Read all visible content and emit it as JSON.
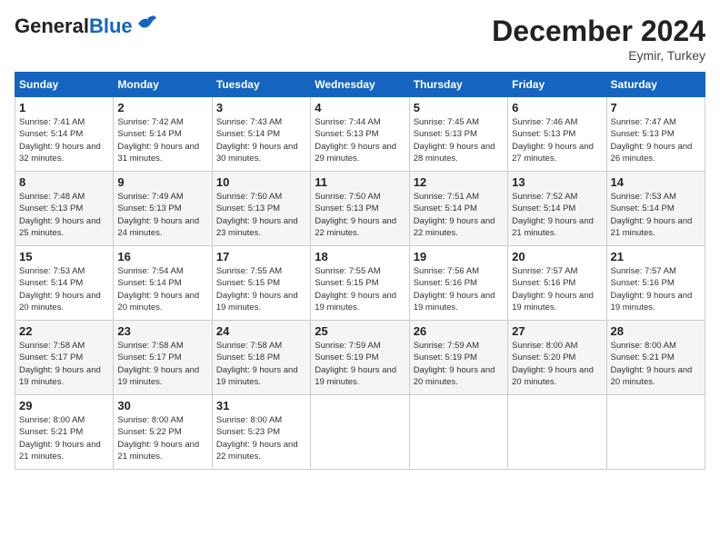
{
  "header": {
    "logo_general": "General",
    "logo_blue": "Blue",
    "month_title": "December 2024",
    "location": "Eymir, Turkey"
  },
  "weekdays": [
    "Sunday",
    "Monday",
    "Tuesday",
    "Wednesday",
    "Thursday",
    "Friday",
    "Saturday"
  ],
  "weeks": [
    [
      {
        "day": "1",
        "sunrise": "Sunrise: 7:41 AM",
        "sunset": "Sunset: 5:14 PM",
        "daylight": "Daylight: 9 hours and 32 minutes."
      },
      {
        "day": "2",
        "sunrise": "Sunrise: 7:42 AM",
        "sunset": "Sunset: 5:14 PM",
        "daylight": "Daylight: 9 hours and 31 minutes."
      },
      {
        "day": "3",
        "sunrise": "Sunrise: 7:43 AM",
        "sunset": "Sunset: 5:14 PM",
        "daylight": "Daylight: 9 hours and 30 minutes."
      },
      {
        "day": "4",
        "sunrise": "Sunrise: 7:44 AM",
        "sunset": "Sunset: 5:13 PM",
        "daylight": "Daylight: 9 hours and 29 minutes."
      },
      {
        "day": "5",
        "sunrise": "Sunrise: 7:45 AM",
        "sunset": "Sunset: 5:13 PM",
        "daylight": "Daylight: 9 hours and 28 minutes."
      },
      {
        "day": "6",
        "sunrise": "Sunrise: 7:46 AM",
        "sunset": "Sunset: 5:13 PM",
        "daylight": "Daylight: 9 hours and 27 minutes."
      },
      {
        "day": "7",
        "sunrise": "Sunrise: 7:47 AM",
        "sunset": "Sunset: 5:13 PM",
        "daylight": "Daylight: 9 hours and 26 minutes."
      }
    ],
    [
      {
        "day": "8",
        "sunrise": "Sunrise: 7:48 AM",
        "sunset": "Sunset: 5:13 PM",
        "daylight": "Daylight: 9 hours and 25 minutes."
      },
      {
        "day": "9",
        "sunrise": "Sunrise: 7:49 AM",
        "sunset": "Sunset: 5:13 PM",
        "daylight": "Daylight: 9 hours and 24 minutes."
      },
      {
        "day": "10",
        "sunrise": "Sunrise: 7:50 AM",
        "sunset": "Sunset: 5:13 PM",
        "daylight": "Daylight: 9 hours and 23 minutes."
      },
      {
        "day": "11",
        "sunrise": "Sunrise: 7:50 AM",
        "sunset": "Sunset: 5:13 PM",
        "daylight": "Daylight: 9 hours and 22 minutes."
      },
      {
        "day": "12",
        "sunrise": "Sunrise: 7:51 AM",
        "sunset": "Sunset: 5:14 PM",
        "daylight": "Daylight: 9 hours and 22 minutes."
      },
      {
        "day": "13",
        "sunrise": "Sunrise: 7:52 AM",
        "sunset": "Sunset: 5:14 PM",
        "daylight": "Daylight: 9 hours and 21 minutes."
      },
      {
        "day": "14",
        "sunrise": "Sunrise: 7:53 AM",
        "sunset": "Sunset: 5:14 PM",
        "daylight": "Daylight: 9 hours and 21 minutes."
      }
    ],
    [
      {
        "day": "15",
        "sunrise": "Sunrise: 7:53 AM",
        "sunset": "Sunset: 5:14 PM",
        "daylight": "Daylight: 9 hours and 20 minutes."
      },
      {
        "day": "16",
        "sunrise": "Sunrise: 7:54 AM",
        "sunset": "Sunset: 5:14 PM",
        "daylight": "Daylight: 9 hours and 20 minutes."
      },
      {
        "day": "17",
        "sunrise": "Sunrise: 7:55 AM",
        "sunset": "Sunset: 5:15 PM",
        "daylight": "Daylight: 9 hours and 19 minutes."
      },
      {
        "day": "18",
        "sunrise": "Sunrise: 7:55 AM",
        "sunset": "Sunset: 5:15 PM",
        "daylight": "Daylight: 9 hours and 19 minutes."
      },
      {
        "day": "19",
        "sunrise": "Sunrise: 7:56 AM",
        "sunset": "Sunset: 5:16 PM",
        "daylight": "Daylight: 9 hours and 19 minutes."
      },
      {
        "day": "20",
        "sunrise": "Sunrise: 7:57 AM",
        "sunset": "Sunset: 5:16 PM",
        "daylight": "Daylight: 9 hours and 19 minutes."
      },
      {
        "day": "21",
        "sunrise": "Sunrise: 7:57 AM",
        "sunset": "Sunset: 5:16 PM",
        "daylight": "Daylight: 9 hours and 19 minutes."
      }
    ],
    [
      {
        "day": "22",
        "sunrise": "Sunrise: 7:58 AM",
        "sunset": "Sunset: 5:17 PM",
        "daylight": "Daylight: 9 hours and 19 minutes."
      },
      {
        "day": "23",
        "sunrise": "Sunrise: 7:58 AM",
        "sunset": "Sunset: 5:17 PM",
        "daylight": "Daylight: 9 hours and 19 minutes."
      },
      {
        "day": "24",
        "sunrise": "Sunrise: 7:58 AM",
        "sunset": "Sunset: 5:18 PM",
        "daylight": "Daylight: 9 hours and 19 minutes."
      },
      {
        "day": "25",
        "sunrise": "Sunrise: 7:59 AM",
        "sunset": "Sunset: 5:19 PM",
        "daylight": "Daylight: 9 hours and 19 minutes."
      },
      {
        "day": "26",
        "sunrise": "Sunrise: 7:59 AM",
        "sunset": "Sunset: 5:19 PM",
        "daylight": "Daylight: 9 hours and 20 minutes."
      },
      {
        "day": "27",
        "sunrise": "Sunrise: 8:00 AM",
        "sunset": "Sunset: 5:20 PM",
        "daylight": "Daylight: 9 hours and 20 minutes."
      },
      {
        "day": "28",
        "sunrise": "Sunrise: 8:00 AM",
        "sunset": "Sunset: 5:21 PM",
        "daylight": "Daylight: 9 hours and 20 minutes."
      }
    ],
    [
      {
        "day": "29",
        "sunrise": "Sunrise: 8:00 AM",
        "sunset": "Sunset: 5:21 PM",
        "daylight": "Daylight: 9 hours and 21 minutes."
      },
      {
        "day": "30",
        "sunrise": "Sunrise: 8:00 AM",
        "sunset": "Sunset: 5:22 PM",
        "daylight": "Daylight: 9 hours and 21 minutes."
      },
      {
        "day": "31",
        "sunrise": "Sunrise: 8:00 AM",
        "sunset": "Sunset: 5:23 PM",
        "daylight": "Daylight: 9 hours and 22 minutes."
      },
      null,
      null,
      null,
      null
    ]
  ]
}
